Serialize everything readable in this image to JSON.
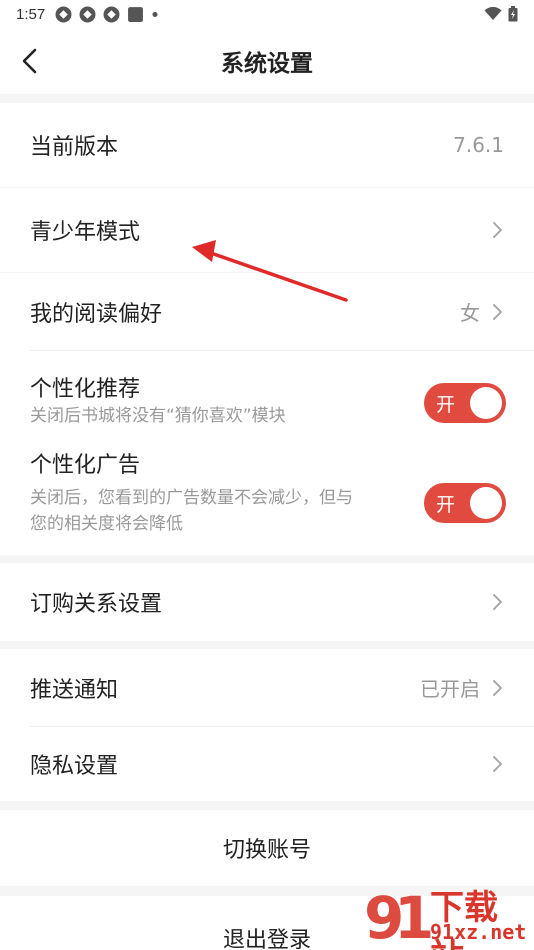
{
  "status_bar": {
    "time": "1:57"
  },
  "header": {
    "title": "系统设置"
  },
  "version": {
    "label": "当前版本",
    "value": "7.6.1"
  },
  "teen_mode": {
    "label": "青少年模式"
  },
  "reading_pref": {
    "label": "我的阅读偏好",
    "value": "女"
  },
  "personal_rec": {
    "label": "个性化推荐",
    "desc": "关闭后书城将没有“猜你喜欢”模块",
    "switch_label": "开"
  },
  "personal_ads": {
    "label": "个性化广告",
    "desc_line1": "关闭后，您看到的广告数量不会减少，但与",
    "desc_line2": "您的相关度将会降低",
    "switch_label": "开"
  },
  "subscription": {
    "label": "订购关系设置"
  },
  "push": {
    "label": "推送通知",
    "value": "已开启"
  },
  "privacy": {
    "label": "隐私设置"
  },
  "switch_account": {
    "label": "切换账号"
  },
  "logout": {
    "label": "退出登录"
  },
  "watermark": {
    "brand": "下载站",
    "url": "91xz.net"
  },
  "colors": {
    "accent": "#e04a3f",
    "annotation": "#e02a2a"
  }
}
